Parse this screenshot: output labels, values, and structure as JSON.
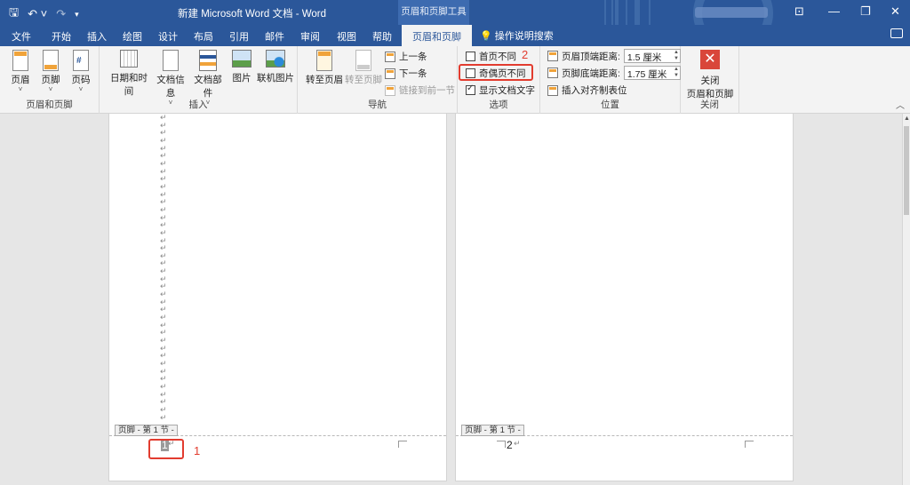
{
  "titlebar": {
    "title": "新建 Microsoft Word 文档  -  Word",
    "context_title": "页眉和页脚工具",
    "qat": {
      "save_icon": "save-icon",
      "undo_icon": "undo-icon",
      "redo_icon": "redo-icon"
    }
  },
  "menu_tabs": [
    "文件",
    "开始",
    "插入",
    "绘图",
    "设计",
    "布局",
    "引用",
    "邮件",
    "审阅",
    "视图",
    "帮助",
    "页眉和页脚"
  ],
  "tell_me": "操作说明搜索",
  "ribbon": {
    "group_header_footer": {
      "label": "页眉和页脚",
      "header": "页眉",
      "footer": "页脚",
      "page_number": "页码"
    },
    "group_insert": {
      "label": "插入",
      "date_time": "日期和时间",
      "doc_info": "文档信息",
      "doc_parts": "文档部件",
      "picture": "图片",
      "online_picture": "联机图片"
    },
    "group_nav": {
      "label": "导航",
      "goto_header": "转至页眉",
      "goto_footer": "转至页脚",
      "previous": "上一条",
      "next": "下一条",
      "link_prev": "链接到前一节"
    },
    "group_options": {
      "label": "选项",
      "diff_first": "首页不同",
      "diff_odd_even": "奇偶页不同",
      "show_doc_text": "显示文档文字"
    },
    "group_position": {
      "label": "位置",
      "header_from_top": "页眉顶端距离:",
      "header_value": "1.5 厘米",
      "footer_from_bottom": "页脚底端距离:",
      "footer_value": "1.75 厘米",
      "insert_align_tab": "插入对齐制表位"
    },
    "group_close": {
      "label": "关闭",
      "close_line1": "关闭",
      "close_line2": "页眉和页脚"
    }
  },
  "annotations": {
    "one": "1",
    "two": "2"
  },
  "pages": [
    {
      "footer_tag": "页脚 - 第 1 节 -",
      "page_number": "1",
      "para_mark": "↵"
    },
    {
      "footer_tag": "页脚 - 第 1 节 -",
      "page_number": "2",
      "para_mark": "↵"
    }
  ],
  "paragraph_marks": [
    "↵",
    "↵",
    "↵",
    "↵",
    "↵",
    "↵",
    "↵",
    "↵",
    "↵",
    "↵",
    "↵",
    "↵",
    "↵",
    "↵",
    "↵",
    "↵",
    "↵",
    "↵",
    "↵",
    "↵",
    "↵",
    "↵",
    "↵",
    "↵",
    "↵",
    "↵",
    "↵",
    "↵",
    "↵",
    "↵",
    "↵",
    "↵",
    "↵",
    "↵",
    "↵",
    "↵",
    "↵",
    "↵",
    "↵",
    "↵"
  ],
  "colors": {
    "title_bar": "#2b579a",
    "annotation_red": "#e23c2f",
    "ribbon_bg": "#f3f3f3"
  }
}
